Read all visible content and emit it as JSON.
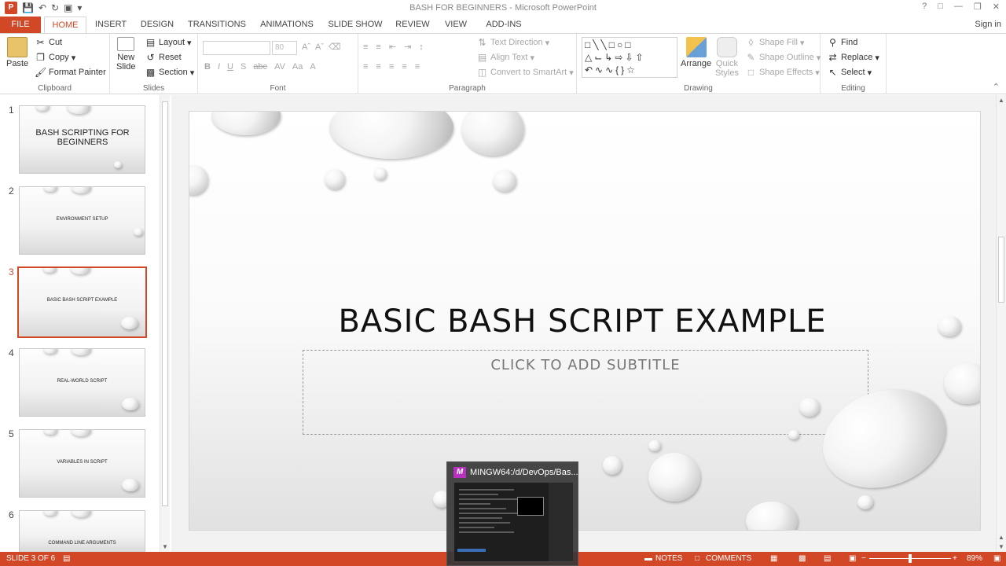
{
  "window": {
    "title": "BASH FOR BEGINNERS - Microsoft PowerPoint",
    "signin": "Sign in"
  },
  "quick_access": {
    "icons": [
      "powerpoint-icon",
      "save-icon",
      "undo-icon",
      "redo-icon",
      "presentation-icon",
      "customize-icon"
    ]
  },
  "tabs": [
    "FILE",
    "HOME",
    "INSERT",
    "DESIGN",
    "TRANSITIONS",
    "ANIMATIONS",
    "SLIDE SHOW",
    "REVIEW",
    "VIEW",
    "ADD-INS"
  ],
  "active_tab": "HOME",
  "ribbon": {
    "clipboard": {
      "label": "Clipboard",
      "paste": "Paste",
      "cut": "Cut",
      "copy": "Copy",
      "format_painter": "Format Painter"
    },
    "slides": {
      "label": "Slides",
      "new_slide_1": "New",
      "new_slide_2": "Slide",
      "layout": "Layout",
      "reset": "Reset",
      "section": "Section"
    },
    "font": {
      "label": "Font",
      "size": "80"
    },
    "paragraph": {
      "label": "Paragraph",
      "text_direction": "Text Direction",
      "align_text": "Align Text",
      "convert": "Convert to SmartArt"
    },
    "drawing": {
      "label": "Drawing",
      "arrange": "Arrange",
      "quick_styles_1": "Quick",
      "quick_styles_2": "Styles",
      "shape_fill": "Shape Fill",
      "shape_outline": "Shape Outline",
      "shape_effects": "Shape Effects"
    },
    "editing": {
      "label": "Editing",
      "find": "Find",
      "replace": "Replace",
      "select": "Select"
    }
  },
  "slides": [
    {
      "num": "1",
      "title": "BASH SCRIPTING FOR BEGINNERS"
    },
    {
      "num": "2",
      "title": "ENVIRONMENT SETUP"
    },
    {
      "num": "3",
      "title": "BASIC BASH SCRIPT EXAMPLE"
    },
    {
      "num": "4",
      "title": "REAL-WORLD SCRIPT"
    },
    {
      "num": "5",
      "title": "VARIABLES IN SCRIPT"
    },
    {
      "num": "6",
      "title": "COMMAND LINE ARGUMENTS"
    }
  ],
  "selected_slide": 3,
  "current_slide": {
    "title": "BASIC BASH SCRIPT EXAMPLE",
    "subtitle_placeholder": "CLICK TO ADD SUBTITLE"
  },
  "status": {
    "slide_info": "SLIDE 3 OF 6",
    "notes": "NOTES",
    "comments": "COMMENTS",
    "zoom": "89%"
  },
  "taskbar_preview": {
    "title": "MINGW64:/d/DevOps/Bas..."
  }
}
